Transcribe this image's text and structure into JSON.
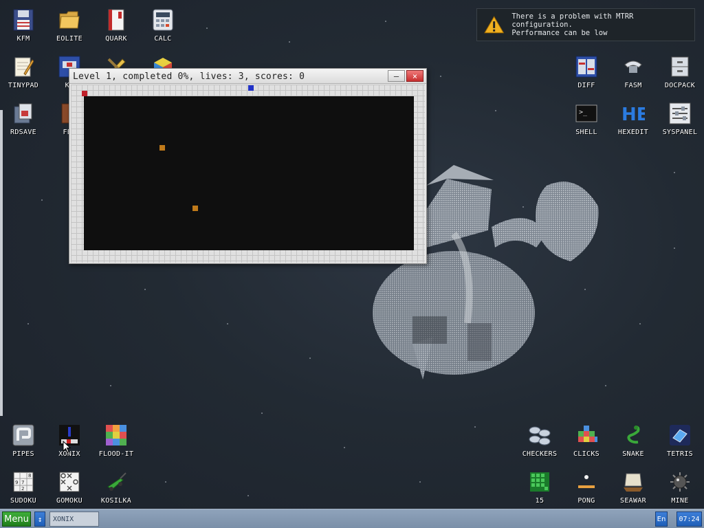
{
  "window": {
    "title": "Level 1, completed 0%, lives: 3, scores: 0",
    "minimize_label": "–",
    "close_label": "×"
  },
  "notification": {
    "line1": "There is a problem with MTRR configuration.",
    "line2": "Performance can be low"
  },
  "desktop_icons": {
    "kfm": "KFM",
    "eolite": "EOLITE",
    "quark": "QUARK",
    "calc": "CALC",
    "tinypad": "TINYPAD",
    "kf": "KF",
    "rdsave": "RDSAVE",
    "fb2": "FB2",
    "diff": "DIFF",
    "fasm": "FASM",
    "docpack": "DOCPACK",
    "shell": "SHELL",
    "hexedit": "HEXEDIT",
    "syspanel": "SYSPANEL",
    "pipes": "PIPES",
    "xonix": "XONIX",
    "floodit": "FLOOD-IT",
    "sudoku": "SUDOKU",
    "gomoku": "GOMOKU",
    "kosilka": "KOSILKA",
    "checkers": "CHECKERS",
    "clicks": "CLICKS",
    "snake": "SNAKE",
    "tetris": "TETRIS",
    "fifteen": "15",
    "pong": "PONG",
    "seawar": "SEAWAR",
    "mine": "MINE"
  },
  "taskbar": {
    "menu_label": "Menu",
    "switch_label": "↕",
    "active_task": "XONIX",
    "language": "En",
    "clock": "07:24"
  },
  "colors": {
    "menu_green": "#2a9a25",
    "taskbar_blue": "#2a6cc8",
    "close_red": "#d03838",
    "player_red": "#c0202a",
    "enemy_blue": "#2233c8",
    "ball_orange": "#c07a1a"
  }
}
